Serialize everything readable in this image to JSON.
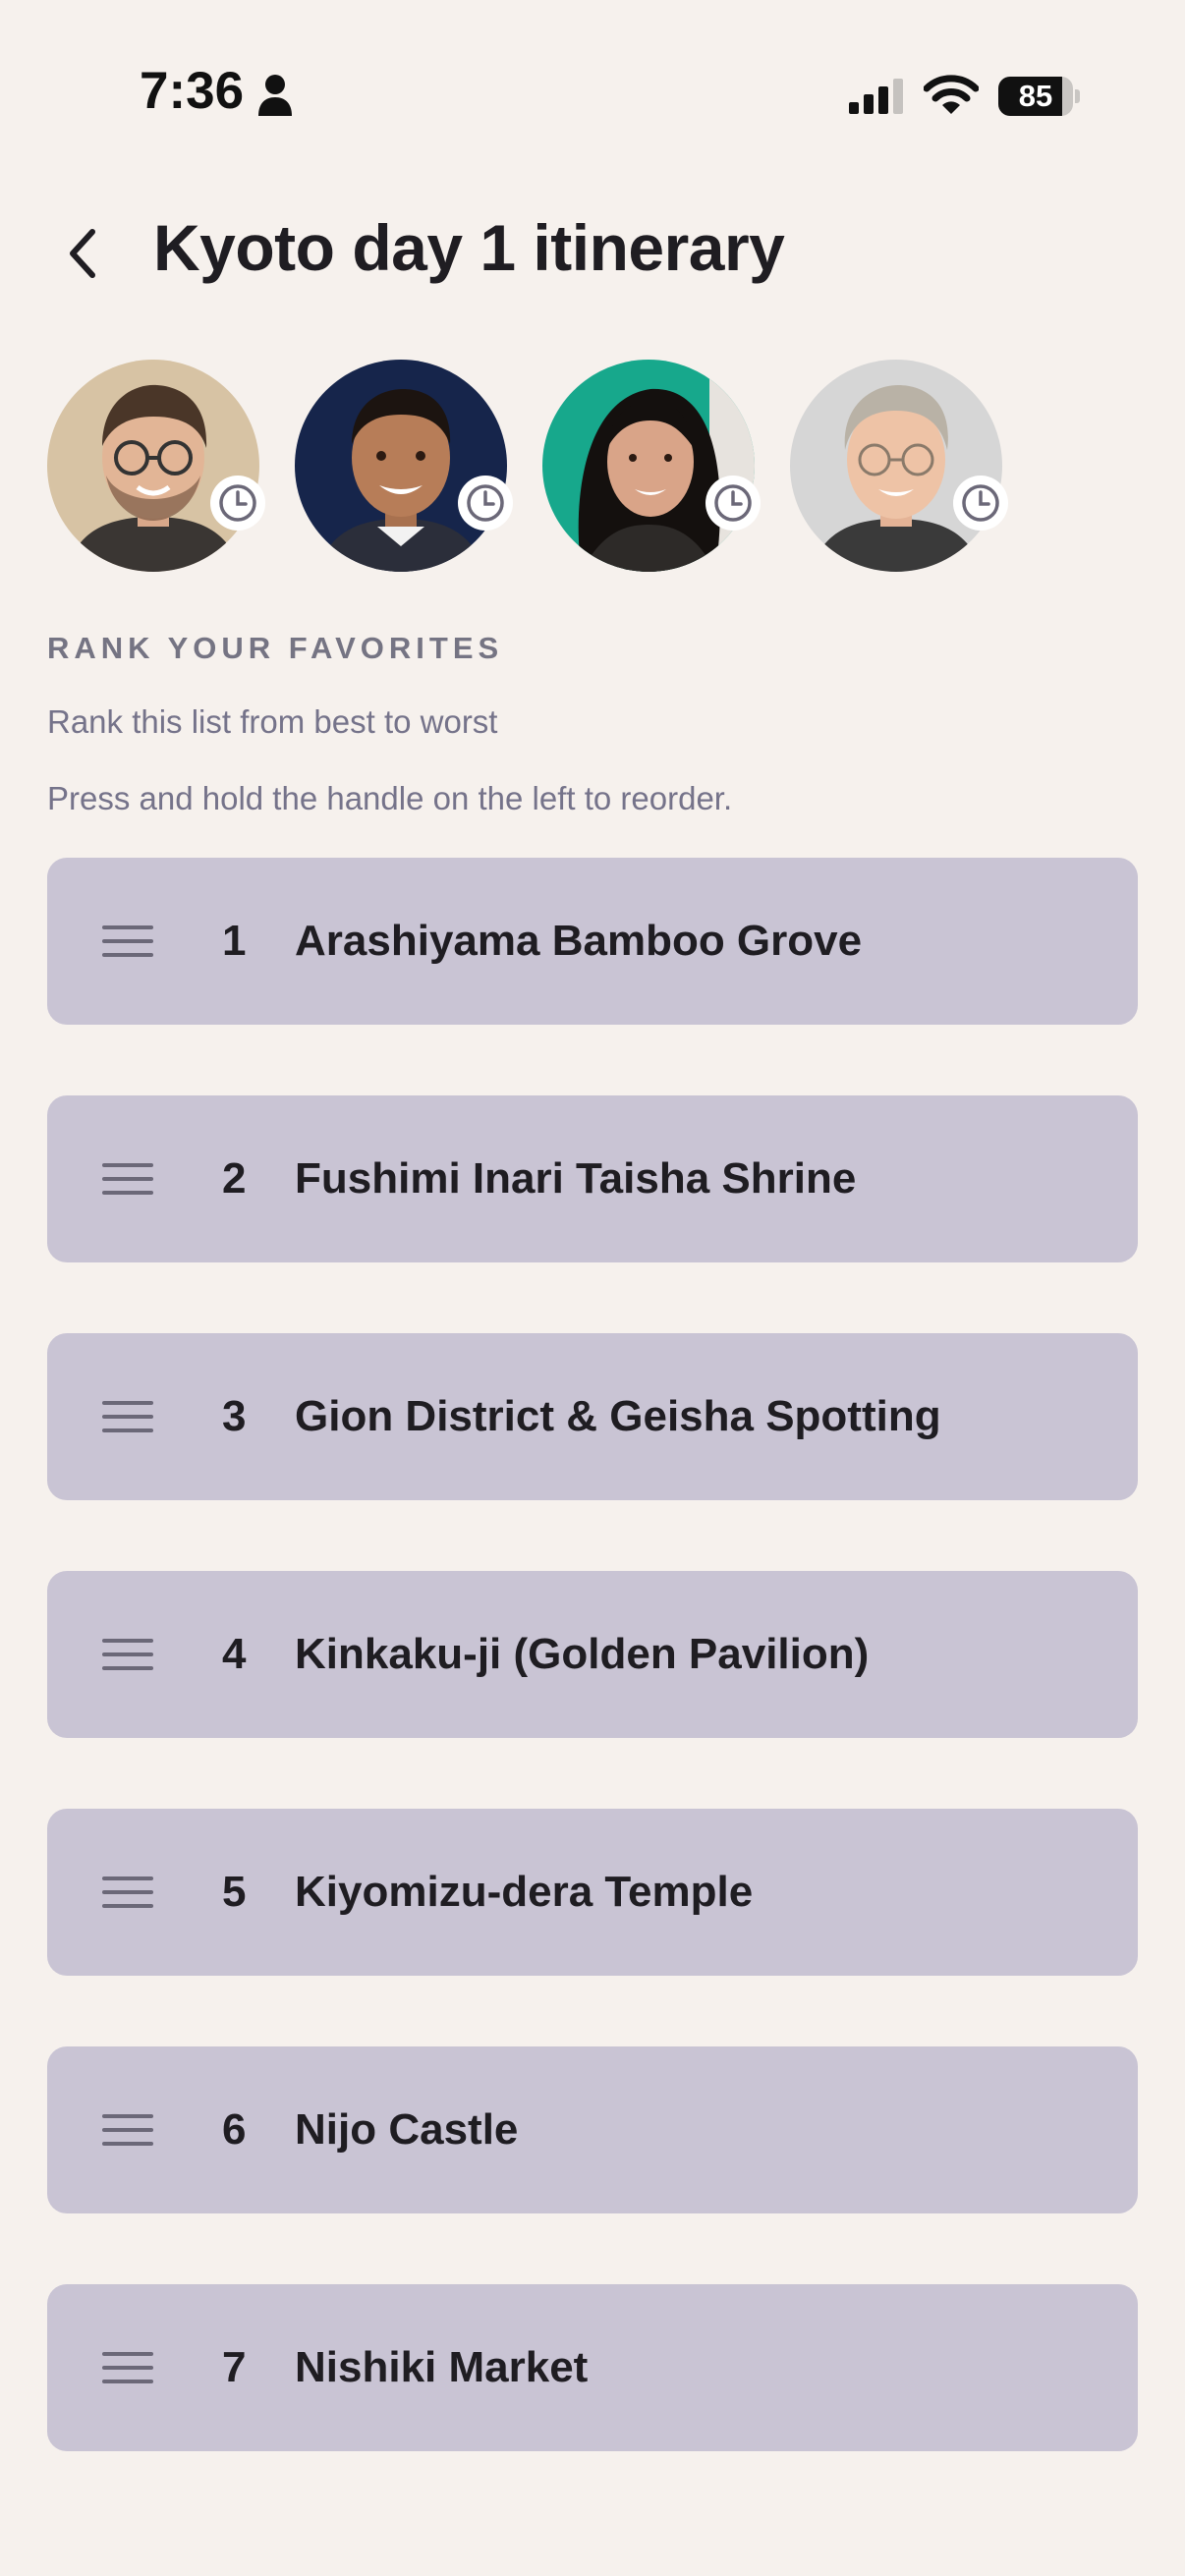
{
  "status_bar": {
    "time": "7:36",
    "battery_percent": "85",
    "battery_level": 0.85,
    "icons": [
      "person-icon",
      "signal-icon",
      "wifi-icon",
      "battery-icon"
    ]
  },
  "header": {
    "back_icon": "chevron-left-icon",
    "title": "Kyoto day 1 itinerary"
  },
  "participants": [
    {
      "avatar": "avatar-man-glasses-beard",
      "status_icon": "clock-icon",
      "bg": "#d7c3a4"
    },
    {
      "avatar": "avatar-man-dark-background",
      "status_icon": "clock-icon",
      "bg": "#16254b"
    },
    {
      "avatar": "avatar-woman-green-background",
      "status_icon": "clock-icon",
      "bg": "#17a88c"
    },
    {
      "avatar": "avatar-older-man-glasses",
      "status_icon": "clock-icon",
      "bg": "#d6d6d6"
    }
  ],
  "ranking": {
    "section_title": "RANK YOUR FAVORITES",
    "instruction_1": "Rank this list from best to worst",
    "instruction_2": "Press and hold the handle on the left to reorder.",
    "handle_icon": "drag-handle-icon",
    "items": [
      {
        "rank": "1",
        "label": "Arashiyama Bamboo Grove"
      },
      {
        "rank": "2",
        "label": "Fushimi Inari Taisha Shrine"
      },
      {
        "rank": "3",
        "label": "Gion District & Geisha Spotting"
      },
      {
        "rank": "4",
        "label": "Kinkaku-ji (Golden Pavilion)"
      },
      {
        "rank": "5",
        "label": "Kiyomizu-dera Temple"
      },
      {
        "rank": "6",
        "label": "Nijo Castle"
      },
      {
        "rank": "7",
        "label": "Nishiki Market"
      }
    ]
  },
  "colors": {
    "background": "#f6f1ed",
    "list_item": "#c9c4d4",
    "text_primary": "#1f1d22",
    "text_secondary": "#75738a"
  }
}
